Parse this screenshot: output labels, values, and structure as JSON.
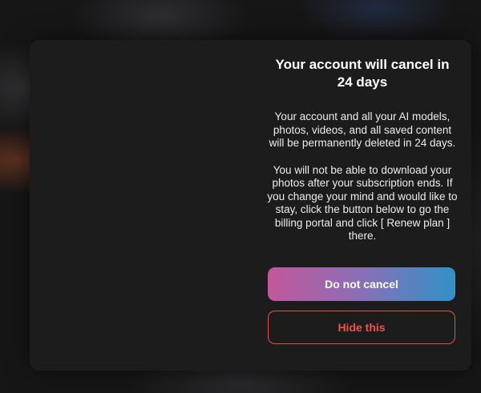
{
  "modal": {
    "title": "Your account will cancel in 24 days",
    "paragraph_1": "Your account and all your AI models, photos, videos, and all saved content will be permanently deleted in 24 days.",
    "paragraph_2": "You will not be able to download your photos after your subscription ends. If you change your mind and would like to stay, click the button below to go the billing portal and click [ Renew plan ] there.",
    "primary_button_label": "Do not cancel",
    "secondary_button_label": "Hide this"
  },
  "colors": {
    "modal_background": "#1c1c1d",
    "gradient_start": "#c2579a",
    "gradient_end": "#2f92c8",
    "danger": "#ec4f3f"
  }
}
